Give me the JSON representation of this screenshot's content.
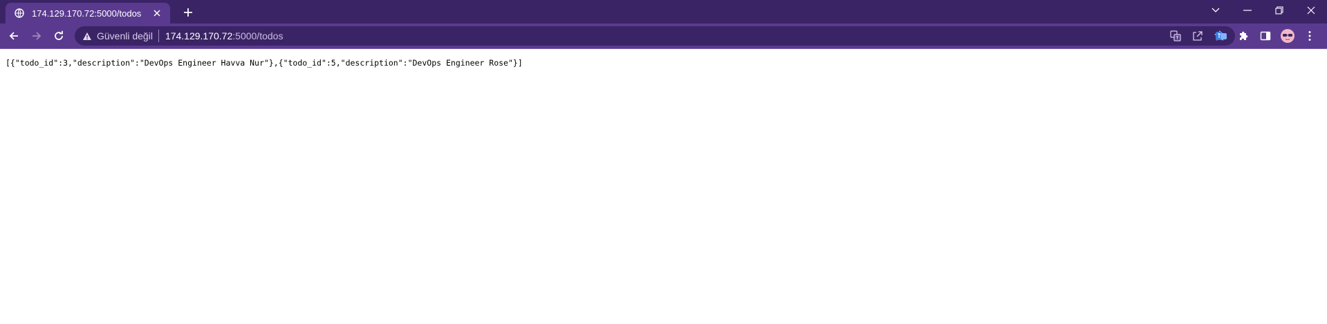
{
  "tab": {
    "title": "174.129.170.72:5000/todos",
    "favicon": "globe-icon"
  },
  "omnibox": {
    "security_label": "Güvenli değil",
    "url_host": "174.129.170.72",
    "url_path": ":5000/todos"
  },
  "content": {
    "json_text": "[{\"todo_id\":3,\"description\":\"DevOps Engineer Havva Nur\"},{\"todo_id\":5,\"description\":\"DevOps Engineer Rose\"}]"
  },
  "colors": {
    "tabstrip": "#3b2466",
    "toolbar": "#5a3a8e",
    "omnibox": "#3b2466"
  },
  "icons": {
    "back": "back-arrow-icon",
    "forward": "forward-arrow-icon",
    "reload": "reload-icon",
    "new_tab": "plus-icon",
    "tab_search": "chevron-down-icon",
    "minimize": "minimize-icon",
    "restore": "restore-icon",
    "close": "close-icon",
    "warning": "warning-icon",
    "translate": "translate-icon",
    "share": "share-icon",
    "bookmark": "star-icon",
    "extension_1": "extension-icon",
    "extensions": "puzzle-icon",
    "side_panel": "side-panel-icon",
    "profile": "avatar",
    "menu": "kebab-menu-icon"
  }
}
